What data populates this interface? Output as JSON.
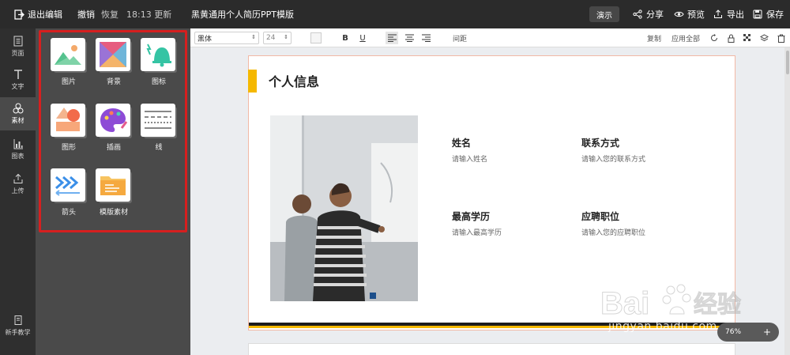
{
  "topbar": {
    "exit_label": "退出编辑",
    "undo_label": "撤销",
    "redo_label": "恢复",
    "save_time": "18:13 更新",
    "doc_title": "黑黄通用个人简历PPT模版",
    "present_label": "演示",
    "share_label": "分享",
    "preview_label": "预览",
    "export_label": "导出",
    "save_label": "保存"
  },
  "leftnav": {
    "items": [
      {
        "label": "页面",
        "icon": "page-icon"
      },
      {
        "label": "文字",
        "icon": "text-icon"
      },
      {
        "label": "素材",
        "icon": "shapes-icon"
      },
      {
        "label": "图表",
        "icon": "chart-icon"
      },
      {
        "label": "上传",
        "icon": "upload-icon"
      }
    ],
    "tutorial_label": "新手教学"
  },
  "panel": {
    "tiles": [
      {
        "label": "图片",
        "icon": "picture-icon"
      },
      {
        "label": "背景",
        "icon": "background-icon"
      },
      {
        "label": "图标",
        "icon": "bell-icon"
      },
      {
        "label": "图形",
        "icon": "shape-icon"
      },
      {
        "label": "插画",
        "icon": "palette-icon"
      },
      {
        "label": "线",
        "icon": "lines-icon"
      },
      {
        "label": "箭头",
        "icon": "arrow-icon"
      },
      {
        "label": "模版素材",
        "icon": "folder-icon"
      }
    ]
  },
  "toolbar": {
    "font_family": "黑体",
    "font_size": "24",
    "bold": "B",
    "underline": "U",
    "spacing_label": "间距",
    "copy_label": "复制",
    "apply_all_label": "应用全部"
  },
  "slide": {
    "title": "个人信息",
    "fields": [
      {
        "label": "姓名",
        "placeholder": "请输入姓名"
      },
      {
        "label": "联系方式",
        "placeholder": "请输入您的联系方式"
      },
      {
        "label": "最高学历",
        "placeholder": "请输入最高学历"
      },
      {
        "label": "应聘职位",
        "placeholder": "请输入您的应聘职位"
      }
    ]
  },
  "zoom": {
    "level": "76%",
    "plus": "+"
  },
  "watermark": {
    "text": "jingyan.baidu.com"
  },
  "colors": {
    "accent_yellow": "#f5b800",
    "frame_red": "#d61f1f",
    "dark_bar": "#2b2b2b"
  }
}
